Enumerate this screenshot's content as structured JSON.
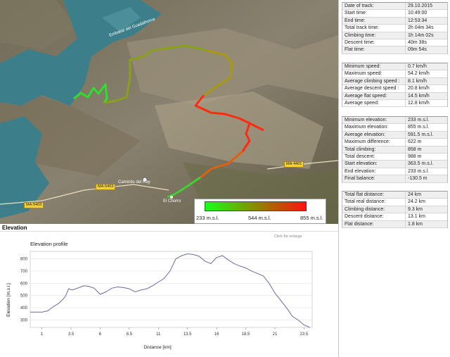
{
  "map": {
    "labels": {
      "reservoir": "Embalse del Guadalhorce",
      "caminito": "Caminito del Rey",
      "town": "El Chorro"
    },
    "roads": [
      "MA-5403",
      "MA-5403",
      "MA-4401"
    ],
    "legend": {
      "min": "233 m.s.l.",
      "mid": "544 m.s.l.",
      "max": "855 m.s.l."
    },
    "colors": {
      "low": "#19ff19",
      "mid": "#8a8a00",
      "high": "#ff1010"
    }
  },
  "stats": {
    "time": [
      {
        "k": "Date of track:",
        "v": "29.10.2015"
      },
      {
        "k": "Start time:",
        "v": "10:49:00"
      },
      {
        "k": "End time:",
        "v": "12:53:34"
      },
      {
        "k": "Total track time:",
        "v": "2h 04m 34s"
      },
      {
        "k": "Climbing time:",
        "v": "1h 14m 02s"
      },
      {
        "k": "Descent time:",
        "v": "40m 38s"
      },
      {
        "k": "Flat time:",
        "v": "09m 54s"
      }
    ],
    "speed": [
      {
        "k": "Minimum speed:",
        "v": "0.7 km/h"
      },
      {
        "k": "Maximum speed:",
        "v": "54.2 km/h"
      },
      {
        "k": "Average climbing speed :",
        "v": "8.1 km/h"
      },
      {
        "k": "Average descent speed :",
        "v": "20.8 km/h"
      },
      {
        "k": "Average flat speed:",
        "v": "14.5 km/h"
      },
      {
        "k": "Average speed:",
        "v": "12.8 km/h"
      }
    ],
    "elevation": [
      {
        "k": "Minimum elevation:",
        "v": "233 m.s.l."
      },
      {
        "k": "Maximum elevation:",
        "v": "855 m.s.l."
      },
      {
        "k": "Average elevation:",
        "v": "591.5 m.s.l."
      },
      {
        "k": "Maximum difference:",
        "v": "622 m"
      },
      {
        "k": "Total climbing:",
        "v": "858 m"
      },
      {
        "k": "Total descent:",
        "v": "988 m"
      },
      {
        "k": "Start elevation:",
        "v": "363.5 m.s.l."
      },
      {
        "k": "End elevation:",
        "v": "233 m.s.l."
      },
      {
        "k": "Final balance:",
        "v": "-130.5 m"
      }
    ],
    "distance": [
      {
        "k": "Total flat distance:",
        "v": "24 km"
      },
      {
        "k": "Total real distance:",
        "v": "24.2 km"
      },
      {
        "k": "Climbing distance:",
        "v": "9.3 km"
      },
      {
        "k": "Descent distance:",
        "v": "13.1 km"
      },
      {
        "k": "Flat distance:",
        "v": "1.8 km"
      }
    ]
  },
  "elevation_section": {
    "title": "Elevation",
    "hint": "Click for enlarge"
  },
  "chart_data": {
    "type": "line",
    "title": "Elevation profile",
    "xlabel": "Distance [km]",
    "ylabel": "Elevation [m.s.l.]",
    "xlim": [
      0,
      24.2
    ],
    "ylim": [
      240,
      860
    ],
    "xticks": [
      "1",
      "3.5",
      "6",
      "8.5",
      "11",
      "13.5",
      "16",
      "18.5",
      "21",
      "23.5"
    ],
    "yticks": [
      "800",
      "700",
      "600",
      "500",
      "400",
      "300"
    ],
    "series": [
      {
        "color": "#6b6b9e",
        "x": [
          0,
          1.0,
          1.5,
          2.0,
          2.5,
          3.0,
          3.3,
          3.6,
          4.2,
          4.6,
          5.0,
          5.5,
          6.0,
          6.5,
          7.0,
          7.5,
          8.0,
          8.5,
          9.0,
          9.5,
          10.0,
          10.5,
          11.0,
          11.5,
          12.0,
          12.5,
          13.0,
          13.5,
          14.0,
          14.5,
          15.0,
          15.5,
          16.0,
          16.5,
          17.0,
          17.5,
          18.0,
          18.5,
          19.0,
          19.5,
          20.0,
          20.5,
          21.0,
          21.5,
          22.0,
          22.5,
          23.0,
          23.5,
          24.0
        ],
        "y": [
          365,
          365,
          375,
          410,
          440,
          490,
          555,
          545,
          565,
          580,
          575,
          560,
          510,
          530,
          560,
          570,
          565,
          555,
          530,
          545,
          555,
          580,
          610,
          640,
          700,
          800,
          825,
          840,
          835,
          820,
          780,
          760,
          810,
          825,
          790,
          760,
          740,
          725,
          700,
          680,
          660,
          600,
          520,
          460,
          400,
          330,
          300,
          260,
          240
        ]
      }
    ]
  }
}
